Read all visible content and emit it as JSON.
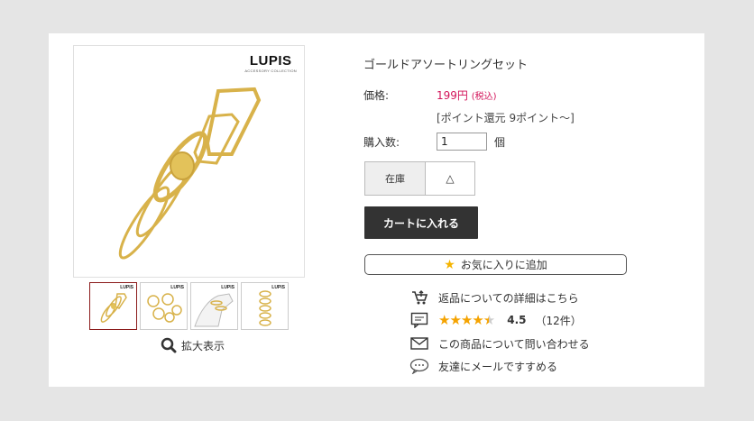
{
  "product": {
    "title": "ゴールドアソートリングセット",
    "brand_logo": "LUPIS",
    "brand_sub": "ACCESSORY COLLECTION",
    "thumb_logo": "LUPIS",
    "zoom_label": "拡大表示"
  },
  "purchase": {
    "price_label": "価格:",
    "price": "199円",
    "tax_note": "(税込)",
    "points": "[ポイント還元 9ポイント〜]",
    "qty_label": "購入数:",
    "qty_value": "1",
    "qty_unit": "個",
    "stock_header": "在庫",
    "stock_value": "△",
    "cart_button": "カートに入れる",
    "favorite_button": "お気に入りに追加"
  },
  "links": {
    "returns": "返品についての詳細はこちら",
    "rating": "4.5",
    "review_count": "（12件）",
    "inquiry": "この商品について問い合わせる",
    "share": "友達にメールですすめる"
  },
  "colors": {
    "accent_price": "#d3145a",
    "star": "#f5a300",
    "cart_bg": "#333333"
  },
  "icons": [
    "cart-return-icon",
    "review-icon",
    "mail-icon",
    "chat-bubble-icon",
    "magnifier-icon",
    "star-icon"
  ]
}
